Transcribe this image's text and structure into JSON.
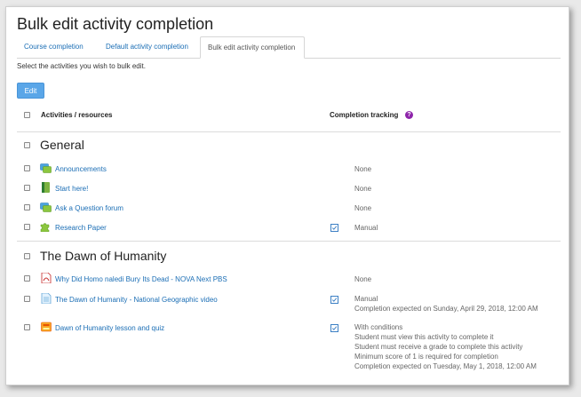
{
  "page": {
    "title": "Bulk edit activity completion",
    "tabs": [
      {
        "label": "Course completion"
      },
      {
        "label": "Default activity completion"
      },
      {
        "label": "Bulk edit activity completion"
      }
    ],
    "instructions": "Select the activities you wish to bulk edit.",
    "edit_label": "Edit"
  },
  "table": {
    "activities_header": "Activities / resources",
    "completion_header": "Completion tracking",
    "help_glyph": "?"
  },
  "sections": [
    {
      "title": "General",
      "items": [
        {
          "name": "Announcements",
          "icon": "forum-icon",
          "tracking": false,
          "status": [
            "None"
          ]
        },
        {
          "name": "Start here!",
          "icon": "book-icon",
          "tracking": false,
          "status": [
            "None"
          ]
        },
        {
          "name": "Ask a Question forum",
          "icon": "forum-icon",
          "tracking": false,
          "status": [
            "None"
          ]
        },
        {
          "name": "Research Paper",
          "icon": "puzzle-icon",
          "tracking": true,
          "status": [
            "Manual"
          ]
        }
      ]
    },
    {
      "title": "The Dawn of Humanity",
      "items": [
        {
          "name": "Why Did Homo naledi Bury Its Dead - NOVA Next PBS",
          "icon": "pdf-icon",
          "tracking": false,
          "status": [
            "None"
          ]
        },
        {
          "name": "The Dawn of Humanity - National Geographic video",
          "icon": "page-icon",
          "tracking": true,
          "status": [
            "Manual",
            "Completion expected on Sunday, April 29, 2018, 12:00 AM"
          ]
        },
        {
          "name": "Dawn of Humanity lesson and quiz",
          "icon": "lesson-icon",
          "tracking": true,
          "status": [
            "With conditions",
            "Student must view this activity to complete it",
            "Student must receive a grade to complete this activity",
            "Minimum score of 1 is required for completion",
            "Completion expected on Tuesday, May 1, 2018, 12:00 AM"
          ]
        }
      ]
    }
  ],
  "colors": {
    "link": "#1b6eb5",
    "button": "#5aa6e8",
    "help": "#8e24aa",
    "check": "#3b7fc4"
  }
}
